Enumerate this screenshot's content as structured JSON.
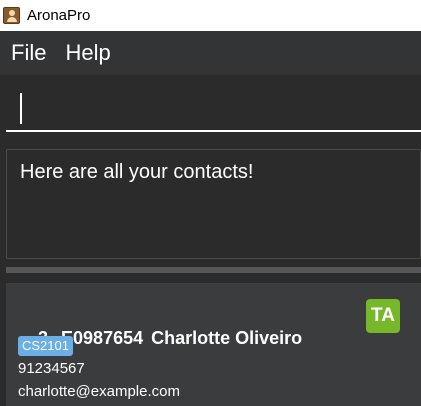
{
  "window": {
    "title": "AronaPro",
    "icon": "app-icon"
  },
  "menu": {
    "items": [
      "File",
      "Help"
    ]
  },
  "command_box": {
    "value": "",
    "placeholder": ""
  },
  "result_display": {
    "text": "Here are all your contacts!"
  },
  "contact": {
    "index": "3.",
    "id": "E0987654",
    "name": "Charlotte Oliveiro",
    "role": "TA",
    "tags": [
      "CS2101"
    ],
    "phone": "91234567",
    "email": "charlotte@example.com"
  },
  "colors": {
    "background": "#2b2b2b",
    "menubar": "#333436",
    "card": "#3b3c3e",
    "role_badge": "#77b82a",
    "tag": "#6ab0e6",
    "text": "#ffffff"
  }
}
